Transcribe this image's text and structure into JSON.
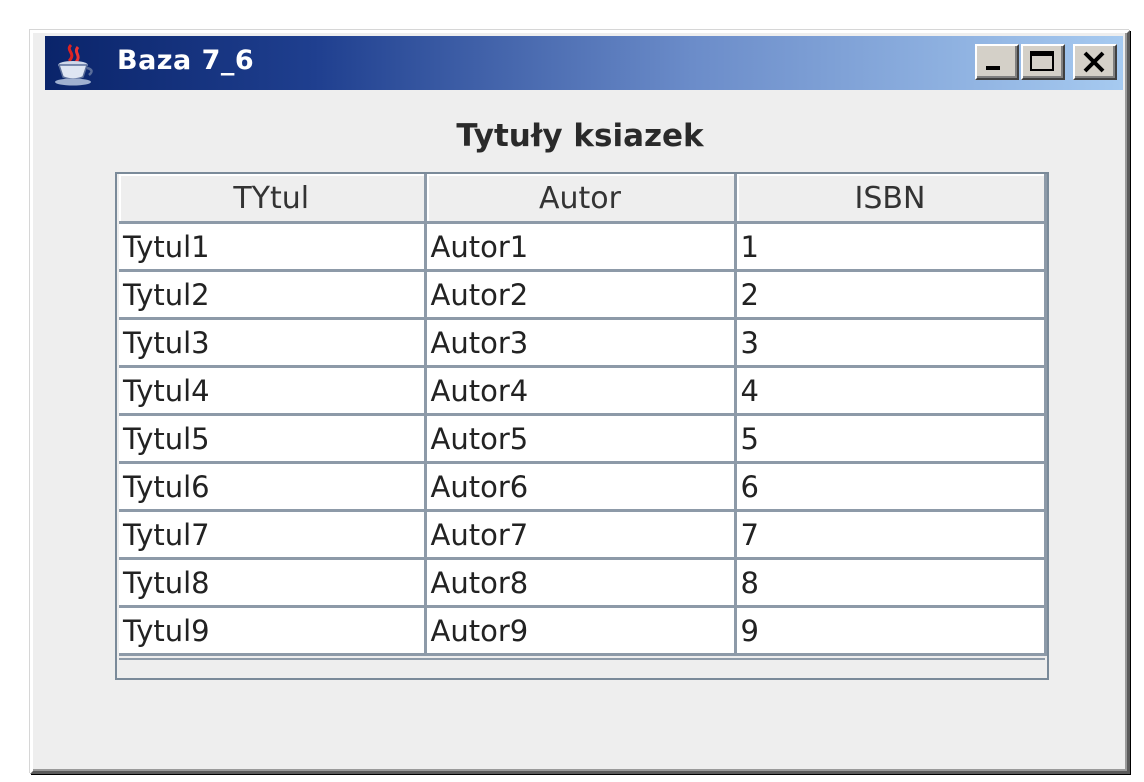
{
  "window": {
    "title": "Baza 7_6",
    "controls": {
      "minimize_icon": "minimize-icon",
      "maximize_icon": "maximize-icon",
      "close_icon": "close-icon"
    },
    "app_icon": "java-cup-icon"
  },
  "main": {
    "heading": "Tytuły ksiazek",
    "table": {
      "columns": [
        "TYtul",
        "Autor",
        "ISBN"
      ],
      "rows": [
        [
          "Tytul1",
          "Autor1",
          "1"
        ],
        [
          "Tytul2",
          "Autor2",
          "2"
        ],
        [
          "Tytul3",
          "Autor3",
          "3"
        ],
        [
          "Tytul4",
          "Autor4",
          "4"
        ],
        [
          "Tytul5",
          "Autor5",
          "5"
        ],
        [
          "Tytul6",
          "Autor6",
          "6"
        ],
        [
          "Tytul7",
          "Autor7",
          "7"
        ],
        [
          "Tytul8",
          "Autor8",
          "8"
        ],
        [
          "Tytul9",
          "Autor9",
          "9"
        ]
      ]
    }
  },
  "colors": {
    "titlebar_start": "#0a246a",
    "titlebar_end": "#a6caf0",
    "window_bg": "#eeeeee",
    "grid_line": "#8d9aa8"
  }
}
